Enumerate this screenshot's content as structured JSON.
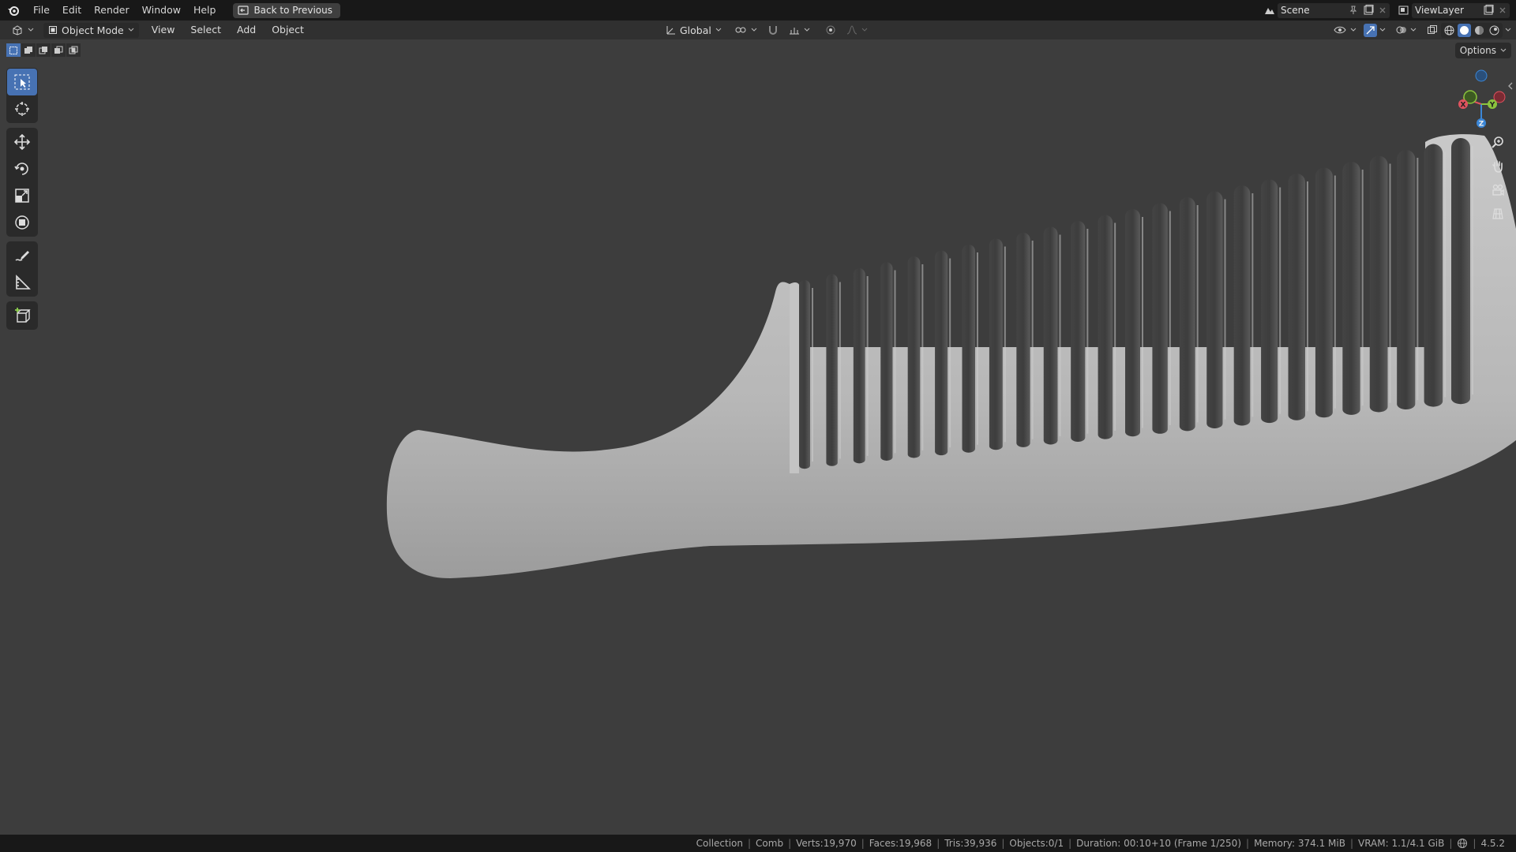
{
  "menubar": {
    "items": [
      "File",
      "Edit",
      "Render",
      "Window",
      "Help"
    ],
    "back_button": "Back to Previous",
    "scene_name": "Scene",
    "view_layer": "ViewLayer"
  },
  "viewport_header": {
    "mode": "Object Mode",
    "menus": [
      "View",
      "Select",
      "Add",
      "Object"
    ],
    "transform_orientation": "Global",
    "options_label": "Options"
  },
  "statusbar": {
    "collection": "Collection",
    "object": "Comb",
    "verts": "Verts:19,970",
    "faces": "Faces:19,968",
    "tris": "Tris:39,936",
    "objects": "Objects:0/1",
    "duration": "Duration: 00:10+10 (Frame 1/250)",
    "memory": "Memory: 374.1 MiB",
    "vram": "VRAM: 1.1/4.1 GiB",
    "version": "4.5.2"
  },
  "gizmo": {
    "x_label": "X",
    "y_label": "Y",
    "z_label": "Z"
  },
  "colors": {
    "accent": "#4772b3",
    "viewport_bg": "#3d3d3d",
    "axis_x": "#e0535f",
    "axis_y": "#8bc43d",
    "axis_z": "#3b86d6"
  }
}
